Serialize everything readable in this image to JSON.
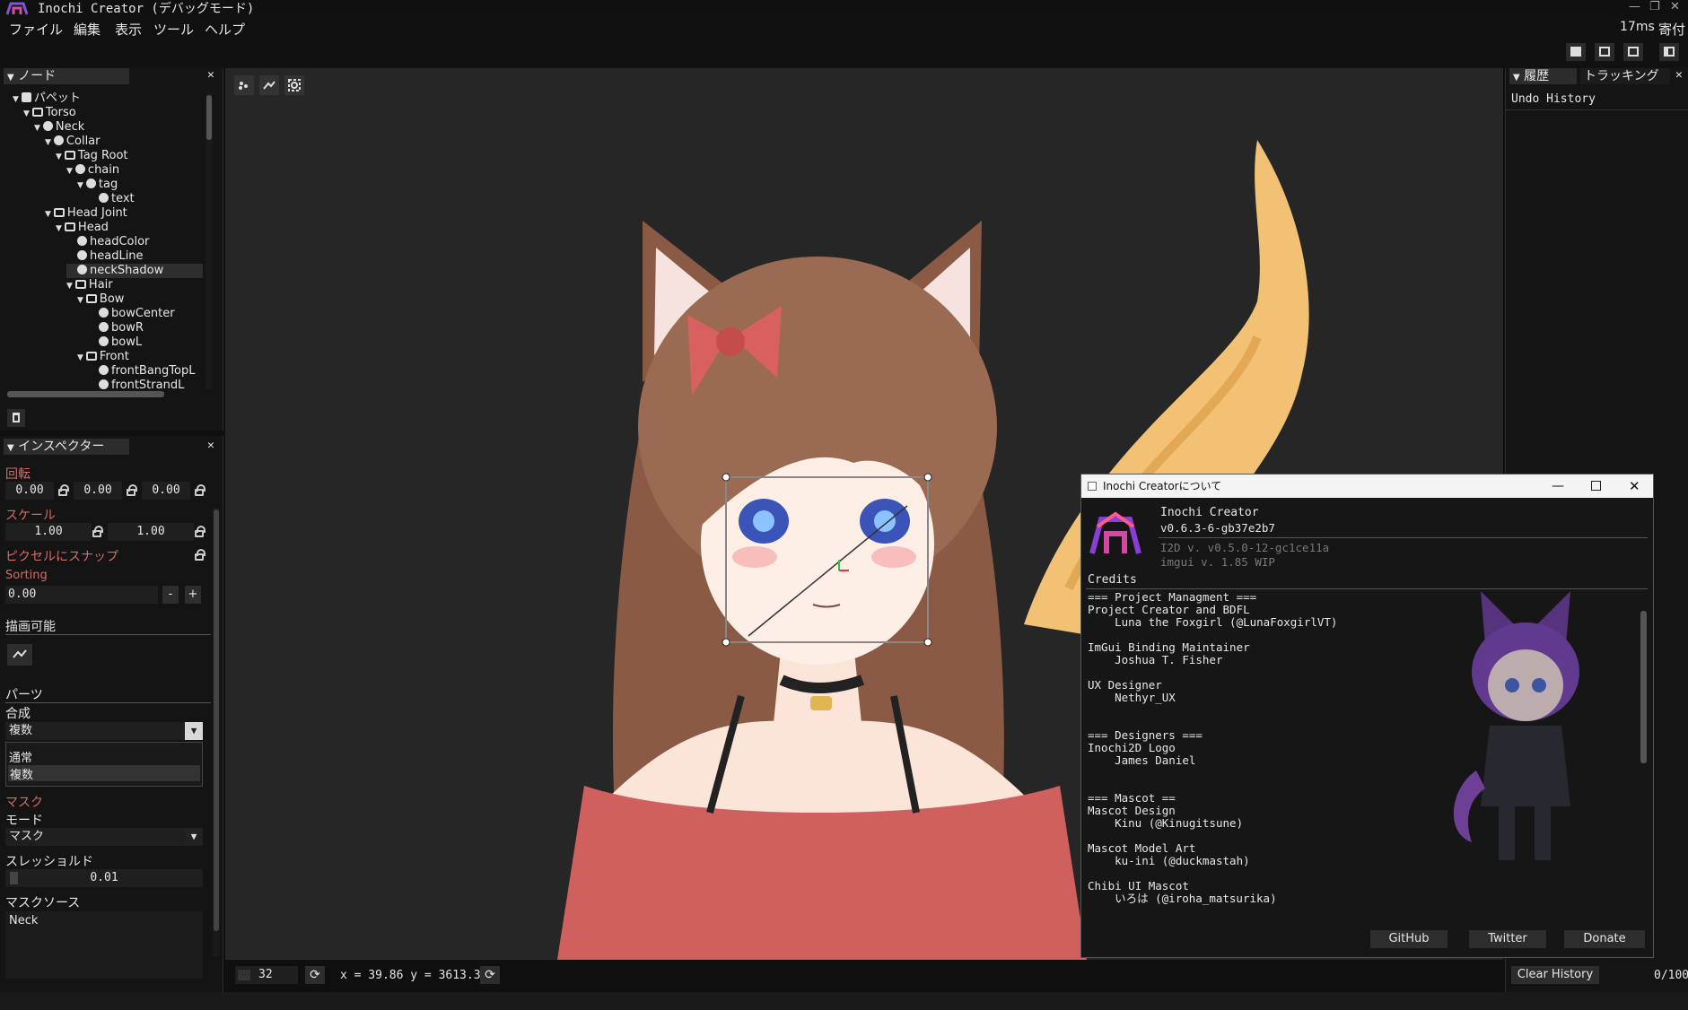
{
  "app": {
    "title": "Inochi Creator (デバッグモード)",
    "fps": "17ms",
    "donate_jp": "寄付"
  },
  "menu": [
    "ファイル",
    "編集",
    "表示",
    "ツール",
    "ヘルプ"
  ],
  "nodes_panel": {
    "title": "ノード",
    "items": [
      {
        "label": "パペット",
        "depth": 0,
        "icon": "puppet-icon",
        "expand": true
      },
      {
        "label": "Torso",
        "depth": 1,
        "icon": "group-icon",
        "expand": true
      },
      {
        "label": "Neck",
        "depth": 2,
        "icon": "node-icon",
        "expand": true
      },
      {
        "label": "Collar",
        "depth": 3,
        "icon": "node-icon",
        "expand": true
      },
      {
        "label": "Tag Root",
        "depth": 4,
        "icon": "group-icon",
        "expand": true
      },
      {
        "label": "chain",
        "depth": 5,
        "icon": "node-icon",
        "expand": true
      },
      {
        "label": "tag",
        "depth": 6,
        "icon": "node-icon",
        "expand": true
      },
      {
        "label": "text",
        "depth": 7,
        "icon": "node-icon",
        "expand": false
      },
      {
        "label": "Head Joint",
        "depth": 3,
        "icon": "group-icon",
        "expand": true
      },
      {
        "label": "Head",
        "depth": 4,
        "icon": "group-icon",
        "expand": true
      },
      {
        "label": "headColor",
        "depth": 5,
        "icon": "node-icon",
        "expand": false
      },
      {
        "label": "headLine",
        "depth": 5,
        "icon": "node-icon",
        "expand": false
      },
      {
        "label": "neckShadow",
        "depth": 5,
        "icon": "node-icon",
        "expand": false,
        "selected": true
      },
      {
        "label": "Hair",
        "depth": 5,
        "icon": "group-icon",
        "expand": true
      },
      {
        "label": "Bow",
        "depth": 6,
        "icon": "group-icon",
        "expand": true
      },
      {
        "label": "bowCenter",
        "depth": 7,
        "icon": "node-icon",
        "expand": false
      },
      {
        "label": "bowR",
        "depth": 7,
        "icon": "node-icon",
        "expand": false
      },
      {
        "label": "bowL",
        "depth": 7,
        "icon": "node-icon",
        "expand": false
      },
      {
        "label": "Front",
        "depth": 6,
        "icon": "group-icon",
        "expand": true
      },
      {
        "label": "frontBangTopL",
        "depth": 7,
        "icon": "node-icon",
        "expand": false
      },
      {
        "label": "frontStrandL",
        "depth": 7,
        "icon": "node-icon",
        "expand": false
      }
    ]
  },
  "inspector": {
    "title": "インスペクター",
    "rotation_label": "回転",
    "rotation": [
      "0.00",
      "0.00",
      "0.00"
    ],
    "scale_label": "スケール",
    "scale": [
      "1.00",
      "1.00"
    ],
    "snap_label": "ピクセルにスナップ",
    "sorting_label": "Sorting",
    "sorting": "0.00",
    "minus": "-",
    "plus": "+",
    "drawable_label": "描画可能",
    "parts_label": "パーツ",
    "blend_label": "合成",
    "blend_value": "複数",
    "blend_options": [
      "通常",
      "複数"
    ],
    "mask_label": "マスク",
    "mode_label": "モード",
    "mode_value": "マスク",
    "threshold_label": "スレッショルド",
    "threshold": "0.01",
    "mask_source_label": "マスクソース",
    "mask_source": "Neck"
  },
  "viewport": {
    "zoom": "32",
    "coords": "x = 39.86 y = 3613.31"
  },
  "right_panel": {
    "tab_history": "履歴",
    "tab_tracking": "トラッキング",
    "undo_title": "Undo History",
    "clear_button": "Clear History",
    "count": "0/100"
  },
  "about": {
    "title": "Inochi Creatorについて",
    "app_name": "Inochi Creator",
    "version": "v0.6.3-6-gb37e2b7",
    "i2d": "I2D v. v0.5.0-12-gc1ce11a",
    "imgui": "imgui v. 1.85 WIP",
    "credits_label": "Credits",
    "credits_text": "=== Project Managment ===\nProject Creator and BDFL\n    Luna the Foxgirl (@LunaFoxgirlVT)\n\nImGui Binding Maintainer\n    Joshua T. Fisher\n\nUX Designer\n    Nethyr_UX\n\n\n=== Designers ===\nInochi2D Logo\n    James Daniel\n\n\n=== Mascot ==\nMascot Design\n    Kinu (@Kinugitsune)\n\nMascot Model Art\n    ku-ini (@duckmastah)\n\nChibi UI Mascot\n    いろは (@iroha_matsurika)",
    "buttons": [
      "GitHub",
      "Twitter",
      "Donate"
    ]
  },
  "colors": {
    "accent": "#6b3aa8",
    "label_red": "#d36b6b",
    "bg": "#262626"
  }
}
